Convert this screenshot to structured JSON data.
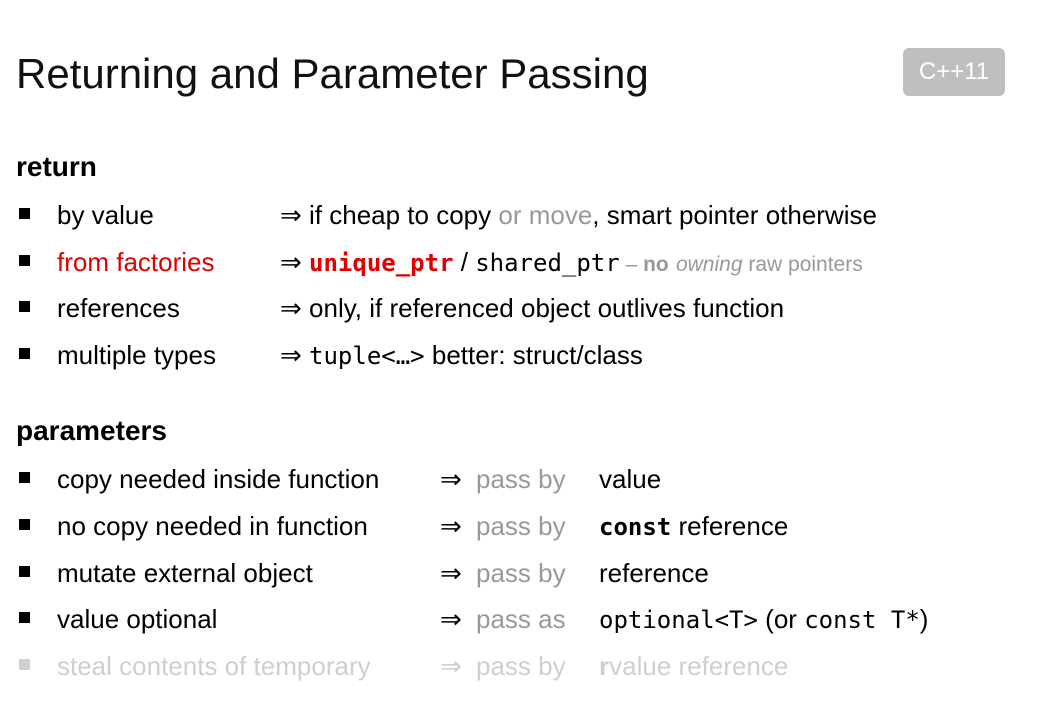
{
  "title": "Returning and Parameter Passing",
  "badge": "C++11",
  "return_section": {
    "heading": "return",
    "rows": [
      {
        "label": "by value",
        "arrow": "⇒",
        "text1": " if cheap to copy",
        "text2": " or move",
        "text3": ", smart pointer otherwise"
      },
      {
        "label": "from factories",
        "arrow": "⇒",
        "code1": "unique_ptr",
        "sep": " / ",
        "code2": "shared_ptr",
        "dash": " – ",
        "no": "no",
        "owning": "owning",
        "rest": " raw pointers"
      },
      {
        "label": "references",
        "arrow": "⇒",
        "text1": " only, if referenced object outlives function"
      },
      {
        "label": "multiple types",
        "arrow": "⇒",
        "code1": "tuple<…>",
        "text2": "better: struct/class"
      }
    ]
  },
  "parameters_section": {
    "heading": "parameters",
    "rows": [
      {
        "label": "copy needed inside function",
        "arrow": "⇒",
        "pass": "pass by",
        "value": "value"
      },
      {
        "label": "no copy needed in function",
        "arrow": "⇒",
        "pass": "pass by",
        "code": "const",
        "value": " reference"
      },
      {
        "label": "mutate external object",
        "arrow": "⇒",
        "pass": "pass by",
        "value": "reference"
      },
      {
        "label": "value optional",
        "arrow": "⇒",
        "pass": "pass as",
        "code": "optional<T>",
        "value": " (or ",
        "code2": "const T*",
        "close": ")"
      },
      {
        "label": "steal contents of temporary",
        "arrow": "⇒",
        "pass": "pass by",
        "bold_r": "r",
        "value": "value reference"
      }
    ]
  },
  "colors": {
    "accent_red": "#e00000",
    "gray_text": "#999999",
    "faint_text": "#cfcfcf",
    "badge_bg": "#bfbfbf"
  }
}
